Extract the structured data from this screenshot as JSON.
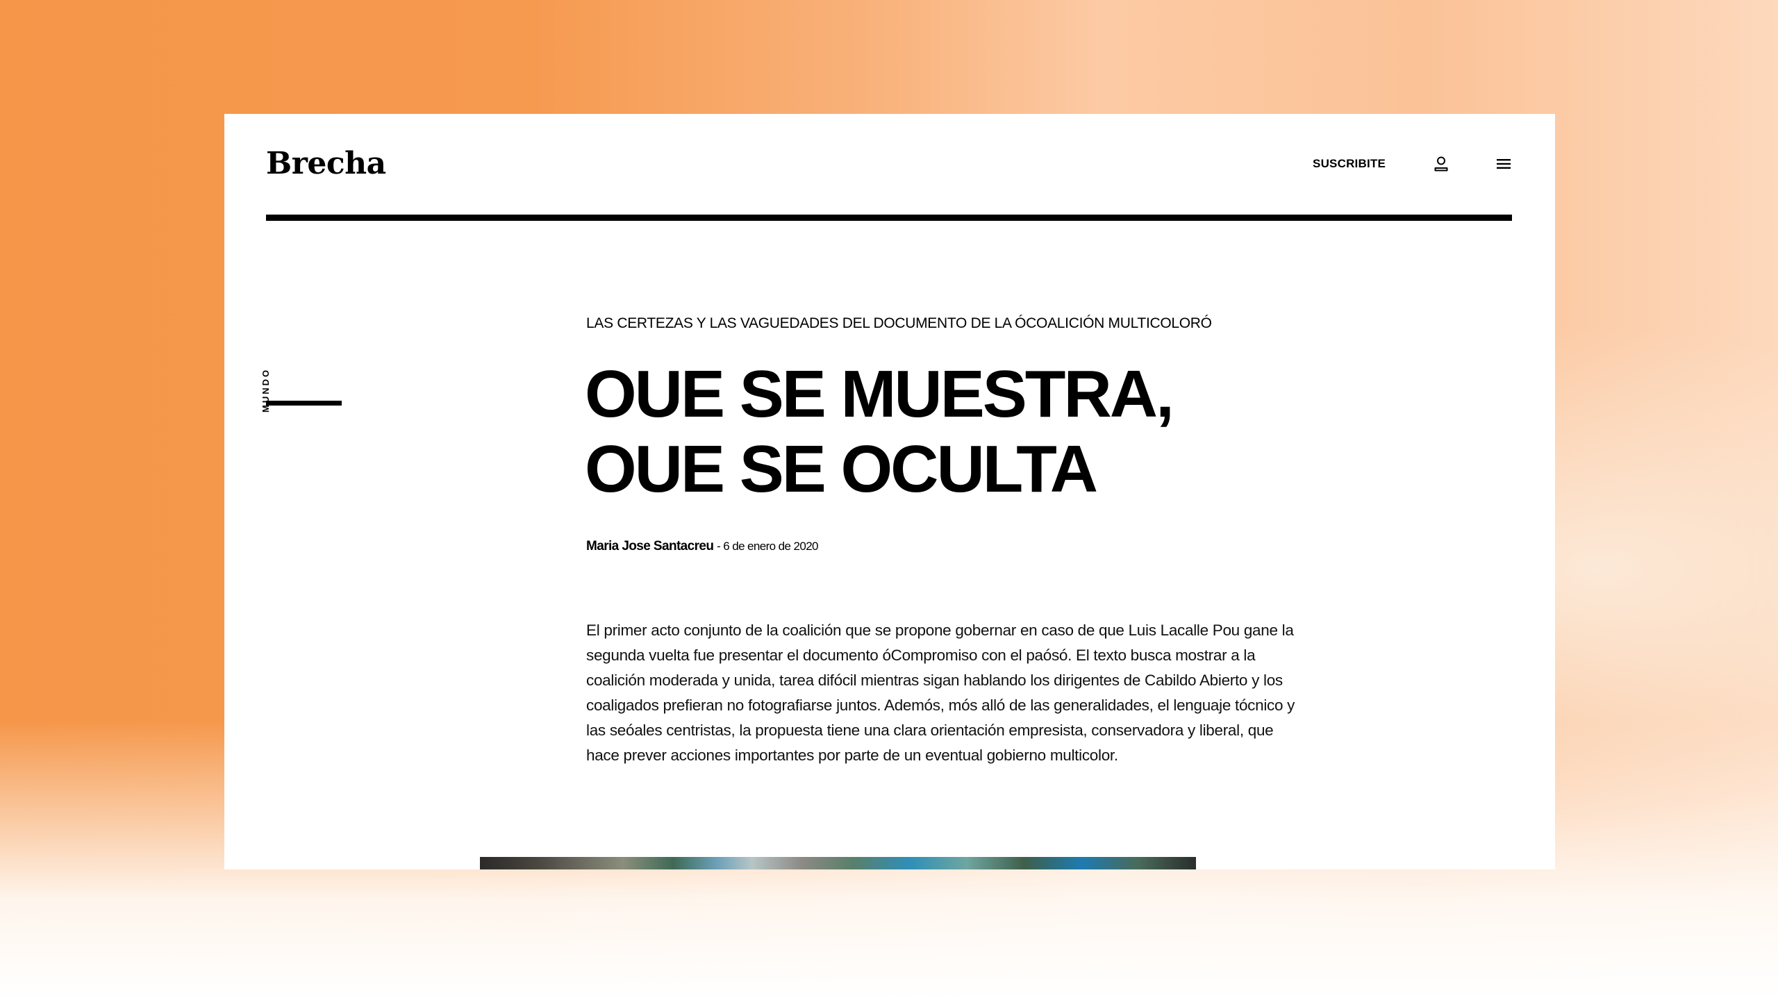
{
  "site": {
    "logo": "Brecha"
  },
  "nav": {
    "subscribe_label": "SUSCRIBITE",
    "user_icon": "user-icon",
    "menu_icon": "hamburger-menu-icon"
  },
  "article": {
    "section": "MUNDO",
    "kicker": "LAS CERTEZAS Y LAS VAGUEDADES DEL DOCUMENTO DE LA ÓCOALICIÓN MULTICOLORÓ",
    "headline_line1": "OUE SE MUESTRA,",
    "headline_line2": "OUE SE OCULTA",
    "author": "Maria Jose Santacreu",
    "date": "- 6 de enero de 2020",
    "lead": "El primer acto conjunto de la coalición que se propone gobernar en caso de que Luis Lacalle Pou gane la segunda vuelta fue presentar el documento óCompromiso con el paósó. El texto busca mostrar a la coalición moderada y unida, tarea difócil mientras sigan hablando los dirigentes de Cabildo Abierto y los coaligados prefieran no fotografiarse juntos. Ademós, mós alló de las generalidades, el lenguaje tócnico y las seóales centristas, la propuesta tiene una clara orientación empresista, conservadora y liberal, que hace prever acciones importantes por parte de un eventual gobierno multicolor."
  },
  "colors": {
    "background_orange": "#f59649",
    "background_peach": "#fccaa4",
    "card": "#ffffff",
    "text": "#000000"
  }
}
